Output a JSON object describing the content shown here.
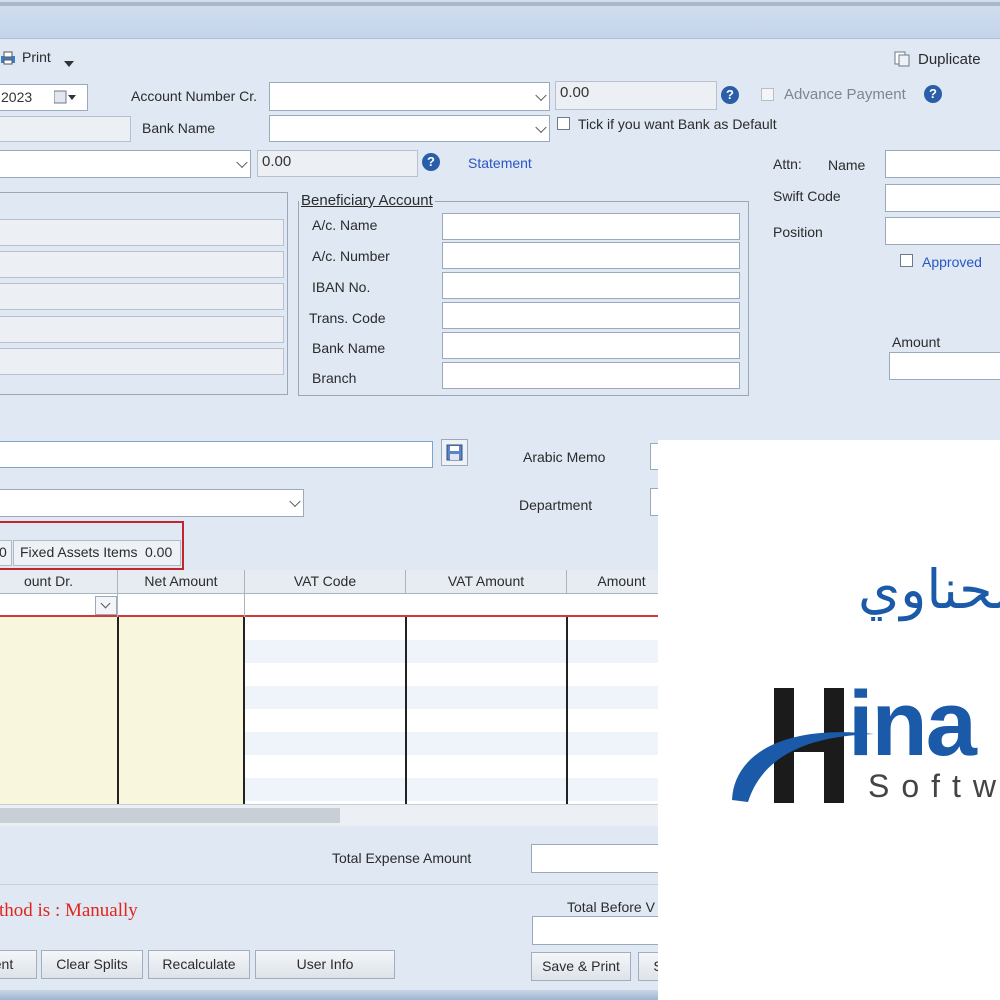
{
  "toolbar": {
    "print_label": "Print",
    "duplicate_label": "Duplicate"
  },
  "header": {
    "date_value": "2023",
    "account_number_cr_label": "Account Number Cr.",
    "account_number_cr_amount": "0.00",
    "advance_payment_label": "Advance Payment",
    "bank_name_label": "Bank Name",
    "bank_default_label": "Tick if you want Bank as Default",
    "account_amount": "0.00",
    "statement_link": "Statement"
  },
  "attn": {
    "attn_label": "Attn:",
    "name_label": "Name",
    "swift_label": "Swift Code",
    "position_label": "Position",
    "approved_label": "Approved",
    "amount_label": "Amount"
  },
  "beneficiary": {
    "title": "Beneficiary Account",
    "fields": [
      "A/c. Name",
      "A/c. Number",
      "IBAN No.",
      "Trans. Code",
      "Bank Name",
      "Branch"
    ]
  },
  "memo": {
    "arabic_memo_label": "Arabic Memo",
    "department_label": "Department"
  },
  "tabs": {
    "left_value": "0",
    "fixed_assets_label": "Fixed Assets Items",
    "fixed_assets_value": "0.00"
  },
  "grid": {
    "headers": [
      "ount Dr.",
      "Net Amount",
      "VAT Code",
      "VAT Amount",
      "Amount"
    ]
  },
  "footer": {
    "total_expense_label": "Total Expense Amount",
    "method_text": "thod is : Manually",
    "total_before_label": "Total Before V",
    "buttons": [
      "ent",
      "Clear Splits",
      "Recalculate",
      "User Info",
      "Save & Print",
      "S"
    ]
  },
  "logo": {
    "arabic_text": "الحناوي",
    "brand_text": "ina",
    "software_text": "Softw"
  },
  "colors": {
    "accent_link": "#2a56c6",
    "warning_red": "#e0261b",
    "grid_highlight": "#f8f6dc",
    "logo_blue": "#1a5aa8"
  }
}
